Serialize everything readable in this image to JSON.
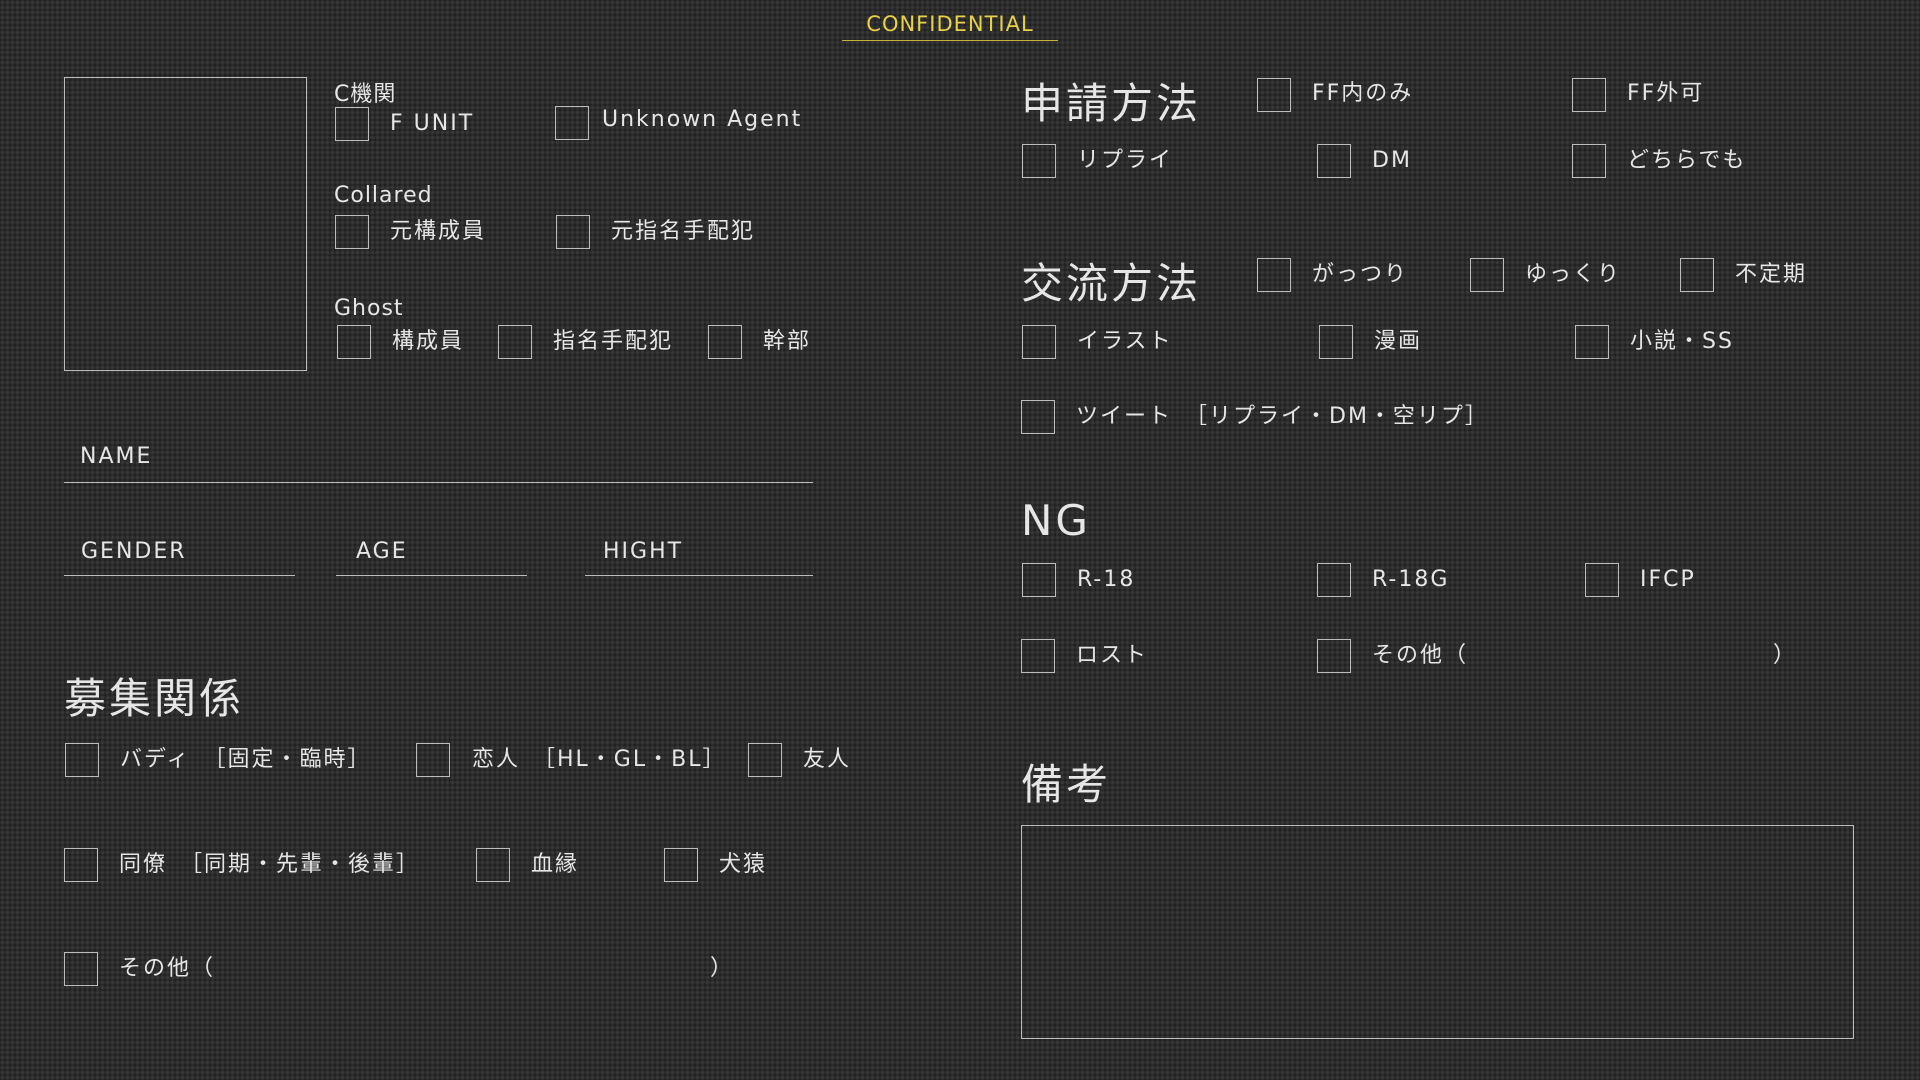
{
  "header": {
    "confidential": "CONFIDENTIAL"
  },
  "affiliation": {
    "c_kikan": {
      "title": "C機関",
      "options": [
        "F UNIT",
        "Unknown Agent"
      ]
    },
    "collared": {
      "title": "Collared",
      "options": [
        "元構成員",
        "元指名手配犯"
      ]
    },
    "ghost": {
      "title": "Ghost",
      "options": [
        "構成員",
        "指名手配犯",
        "幹部"
      ]
    }
  },
  "profile": {
    "name": "NAME",
    "gender": "GENDER",
    "age": "AGE",
    "hight": "HIGHT"
  },
  "recruit": {
    "title": "募集関係",
    "buddy": "バディ　［固定・臨時］",
    "lover": "恋人　［HL・GL・BL］",
    "friend": "友人",
    "colleague": "同僚　［同期・先輩・後輩］",
    "blood": "血縁",
    "rival": "犬猿",
    "other": "その他（",
    "other_close": "）"
  },
  "application": {
    "title": "申請方法",
    "options": [
      "FF内のみ",
      "FF外可",
      "リプライ",
      "DM",
      "どちらでも"
    ]
  },
  "interaction": {
    "title": "交流方法",
    "options": [
      "がっつり",
      "ゆっくり",
      "不定期",
      "イラスト",
      "漫画",
      "小説・SS",
      "ツイート　［リプライ・DM・空リプ］"
    ]
  },
  "ng": {
    "title": "NG",
    "options": [
      "R-18",
      "R-18G",
      "IFCP",
      "ロスト",
      "その他（"
    ],
    "other_close": "）"
  },
  "notes": {
    "title": "備考"
  }
}
